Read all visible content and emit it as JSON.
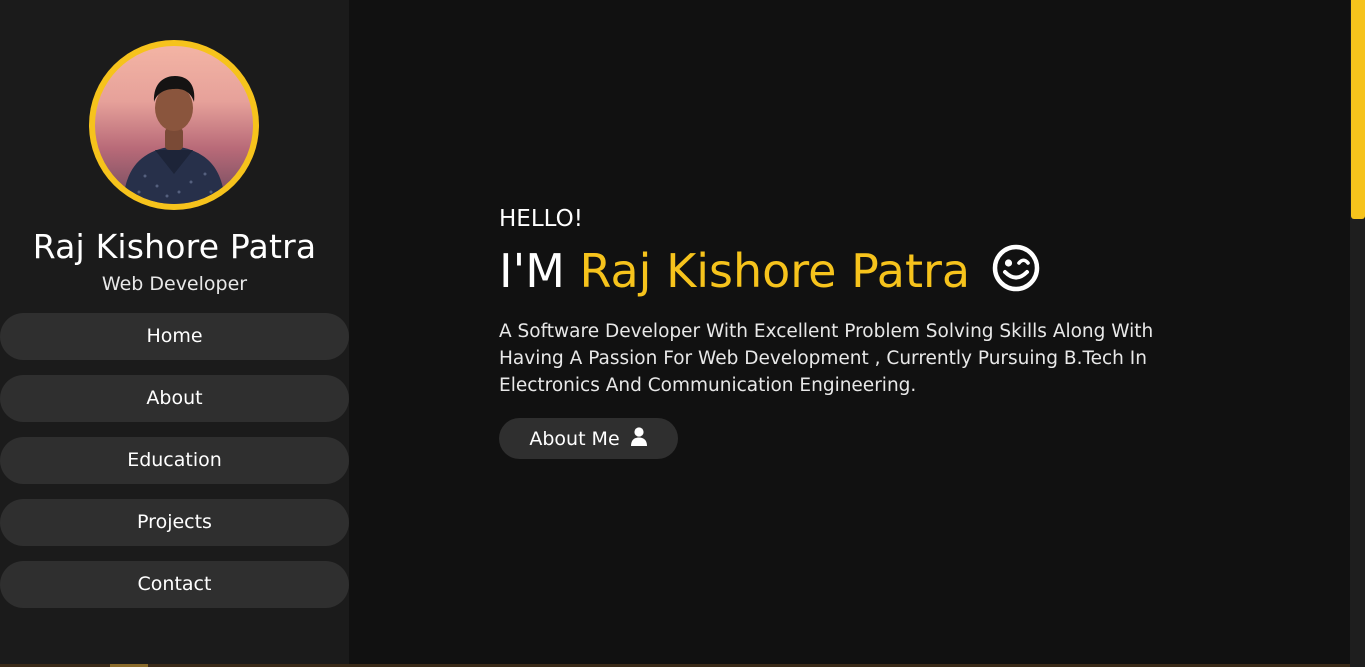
{
  "profile": {
    "name": "Raj Kishore Patra",
    "role": "Web Developer",
    "avatar_icon": "profile-photo"
  },
  "nav": {
    "items": [
      {
        "label": "Home"
      },
      {
        "label": "About"
      },
      {
        "label": "Education"
      },
      {
        "label": "Projects"
      },
      {
        "label": "Contact"
      }
    ]
  },
  "hero": {
    "greeting": "HELLO!",
    "prefix": "I'M",
    "name": "Raj Kishore Patra",
    "emoji_icon": "wink-face-icon",
    "intro": "A Software Developer With Excellent Problem Solving Skills Along With Having A Passion For Web Development , Currently Pursuing B.Tech In Electronics And Communication Engineering.",
    "button_label": "About Me",
    "button_icon": "user-icon"
  },
  "colors": {
    "accent": "#f6c31c",
    "background": "#111111",
    "sidebar": "#1b1b1b",
    "nav_button": "#2f2f2f"
  }
}
